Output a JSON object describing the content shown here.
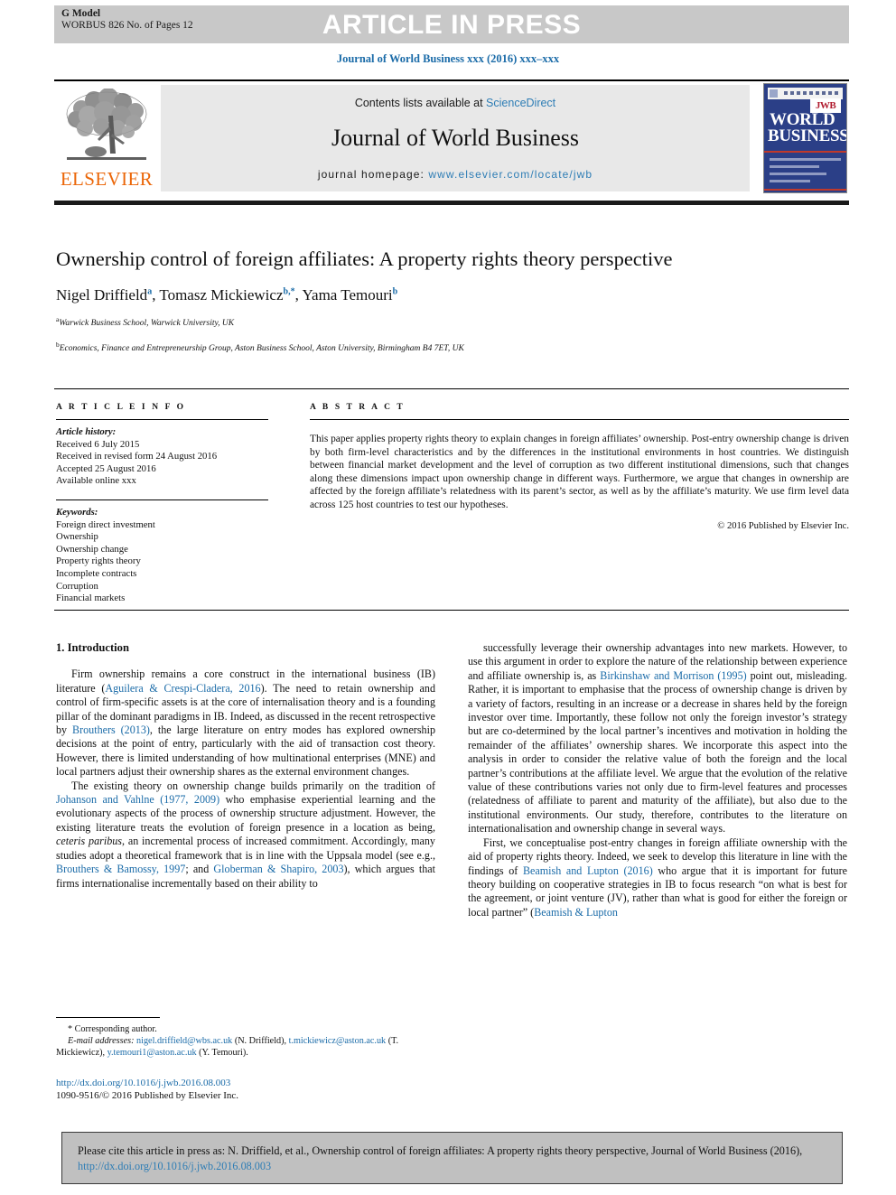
{
  "banner": {
    "gmodel_line1": "G Model",
    "gmodel_line2": "WORBUS 826 No. of Pages 12",
    "article_in_press": "ARTICLE IN PRESS",
    "running_head": "Journal of World Business xxx (2016) xxx–xxx"
  },
  "masthead": {
    "publisher_name": "ELSEVIER",
    "contents_line": "Contents lists available at ",
    "sciencedirect": "ScienceDirect",
    "journal_title": "Journal of World Business",
    "homepage_label": "journal homepage: ",
    "homepage_url": "www.elsevier.com/locate/jwb",
    "cover": {
      "line1": "WORLD",
      "line2": "BUSINESS",
      "badge": "JWB"
    }
  },
  "article": {
    "title": "Ownership control of foreign affiliates: A property rights theory perspective",
    "authors_html": "Nigel Driffield<sup>a</sup>, Tomasz Mickiewicz<sup>b,*</sup>, Yama Temouri<sup>b</sup>",
    "affiliations": [
      {
        "marker": "a",
        "text": "Warwick Business School, Warwick University, UK"
      },
      {
        "marker": "b",
        "text": "Economics, Finance and Entrepreneurship Group, Aston Business School, Aston University, Birmingham B4 7ET, UK"
      }
    ]
  },
  "article_info": {
    "heading": "A R T I C L E  I N F O",
    "history_label": "Article history:",
    "history": [
      "Received 6 July 2015",
      "Received in revised form 24 August 2016",
      "Accepted 25 August 2016",
      "Available online xxx"
    ],
    "keywords_label": "Keywords:",
    "keywords": [
      "Foreign direct investment",
      "Ownership",
      "Ownership change",
      "Property rights theory",
      "Incomplete contracts",
      "Corruption",
      "Financial markets"
    ]
  },
  "abstract": {
    "heading": "A B S T R A C T",
    "text": "This paper applies property rights theory to explain changes in foreign affiliates’ ownership. Post-entry ownership change is driven by both firm-level characteristics and by the differences in the institutional environments in host countries. We distinguish between financial market development and the level of corruption as two different institutional dimensions, such that changes along these dimensions impact upon ownership change in different ways. Furthermore, we argue that changes in ownership are affected by the foreign affiliate’s relatedness with its parent’s sector, as well as by the affiliate’s maturity. We use firm level data across 125 host countries to test our hypotheses.",
    "copyright": "© 2016 Published by Elsevier Inc."
  },
  "body": {
    "section_heading": "1. Introduction",
    "left_paragraphs": [
      "Firm ownership remains a core construct in the international business (IB) literature (<span class=\"cit\">Aguilera &amp; Crespi-Cladera, 2016</span>). The need to retain ownership and control of firm-specific assets is at the core of internalisation theory and is a founding pillar of the dominant paradigms in IB. Indeed, as discussed in the recent retrospective by <span class=\"cit\">Brouthers (2013)</span>, the large literature on entry modes has explored ownership decisions at the point of entry, particularly with the aid of transaction cost theory. However, there is limited understanding of how multinational enterprises (MNE) and local partners adjust their ownership shares as the external environment changes.",
      "The existing theory on ownership change builds primarily on the tradition of <span class=\"cit\">Johanson and Vahlne (1977, 2009)</span> who emphasise experiential learning and the evolutionary aspects of the process of ownership structure adjustment. However, the existing literature treats the evolution of foreign presence in a location as being, <span class=\"it\">ceteris paribus</span>, an incremental process of increased commitment. Accordingly, many studies adopt a theoretical framework that is in line with the Uppsala model (see e.g., <span class=\"cit\">Brouthers &amp; Bamossy, 1997</span>; and <span class=\"cit\">Globerman &amp; Shapiro, 2003</span>), which argues that firms internationalise incrementally based on their ability to"
    ],
    "right_paragraphs": [
      "successfully leverage their ownership advantages into new markets. However, to use this argument in order to explore the nature of the relationship between experience and affiliate ownership is, as <span class=\"cit\">Birkinshaw and Morrison (1995)</span> point out, misleading. Rather, it is important to emphasise that the process of ownership change is driven by a variety of factors, resulting in an increase or a decrease in shares held by the foreign investor over time. Importantly, these follow not only the foreign investor’s strategy but are co-determined by the local partner’s incentives and motivation in holding the remainder of the affiliates’ ownership shares. We incorporate this aspect into the analysis in order to consider the relative value of both the foreign and the local partner’s contributions at the affiliate level. We argue that the evolution of the relative value of these contributions varies not only due to firm-level features and processes (relatedness of affiliate to parent and maturity of the affiliate), but also due to the institutional environments. Our study, therefore, contributes to the literature on internationalisation and ownership change in several ways.",
      "First, we conceptualise post-entry changes in foreign affiliate ownership with the aid of property rights theory. Indeed, we seek to develop this literature in line with the findings of <span class=\"cit\">Beamish and Lupton (2016)</span> who argue that it is important for future theory building on cooperative strategies in IB to focus research “on what is best for the agreement, or joint venture (JV), rather than what is good for either the foreign or local partner” (<span class=\"cit\">Beamish &amp; Lupton</span>"
    ]
  },
  "footnotes": {
    "corresponding": "* Corresponding author.",
    "email_label": "E-mail addresses:",
    "emails_html": " <span class=\"cit\">nigel.driffield@wbs.ac.uk</span> (N. Driffield), <span class=\"cit\">t.mickiewicz@aston.ac.uk</span> (T. Mickiewicz), <span class=\"cit\">y.temouri1@aston.ac.uk</span> (Y. Temouri).",
    "doi": "http://dx.doi.org/10.1016/j.jwb.2016.08.003",
    "issn_line": "1090-9516/© 2016 Published by Elsevier Inc."
  },
  "cite_box": {
    "text_before": "Please cite this article in press as: N. Driffield, et al., Ownership control of foreign affiliates: A property rights theory perspective, Journal of World Business (2016), ",
    "doi_link": "http://dx.doi.org/10.1016/j.jwb.2016.08.003"
  },
  "colors": {
    "link_blue": "#1a6ba8",
    "accent_blue": "#2e7db5",
    "elsevier_orange": "#eb6608",
    "banner_gray": "#c8c8c8",
    "cover_navy": "#2b3f87"
  }
}
